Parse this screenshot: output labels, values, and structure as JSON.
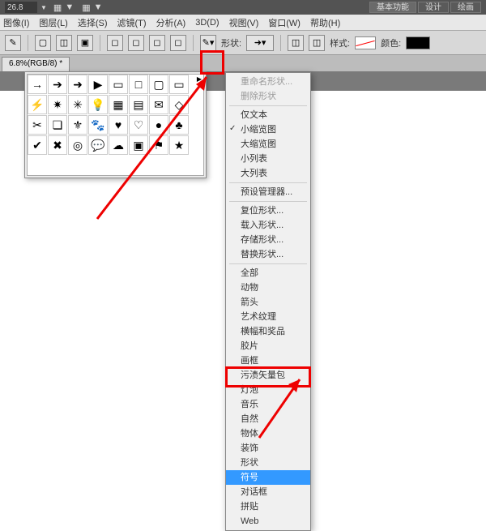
{
  "topbar": {
    "zoom": "26.8",
    "modes": [
      "基本功能",
      "设计",
      "绘画"
    ]
  },
  "menu": [
    "图像(I)",
    "图层(L)",
    "选择(S)",
    "滤镜(T)",
    "分析(A)",
    "3D(D)",
    "视图(V)",
    "窗口(W)",
    "帮助(H)"
  ],
  "options": {
    "shape_label": "形状:",
    "style_label": "样式:",
    "color_label": "颜色:"
  },
  "doc_tab": "6.8%(RGB/8) *",
  "context_menu": {
    "sections": [
      [
        {
          "label": "重命名形状...",
          "disabled": true
        },
        {
          "label": "删除形状",
          "disabled": true
        }
      ],
      [
        {
          "label": "仅文本"
        },
        {
          "label": "小缩览图",
          "checked": true
        },
        {
          "label": "大缩览图"
        },
        {
          "label": "小列表"
        },
        {
          "label": "大列表"
        }
      ],
      [
        {
          "label": "预设管理器..."
        }
      ],
      [
        {
          "label": "复位形状..."
        },
        {
          "label": "载入形状..."
        },
        {
          "label": "存储形状..."
        },
        {
          "label": "替换形状..."
        }
      ],
      [
        {
          "label": "全部"
        },
        {
          "label": "动物"
        },
        {
          "label": "箭头"
        },
        {
          "label": "艺术纹理"
        },
        {
          "label": "横幅和奖品"
        },
        {
          "label": "胶片"
        },
        {
          "label": "画框"
        },
        {
          "label": "污渍矢量包"
        },
        {
          "label": "灯泡"
        },
        {
          "label": "音乐"
        },
        {
          "label": "自然"
        },
        {
          "label": "物体"
        },
        {
          "label": "装饰"
        },
        {
          "label": "形状"
        },
        {
          "label": "符号",
          "selected": true
        },
        {
          "label": "对话框"
        },
        {
          "label": "拼贴"
        },
        {
          "label": "Web"
        }
      ]
    ]
  }
}
